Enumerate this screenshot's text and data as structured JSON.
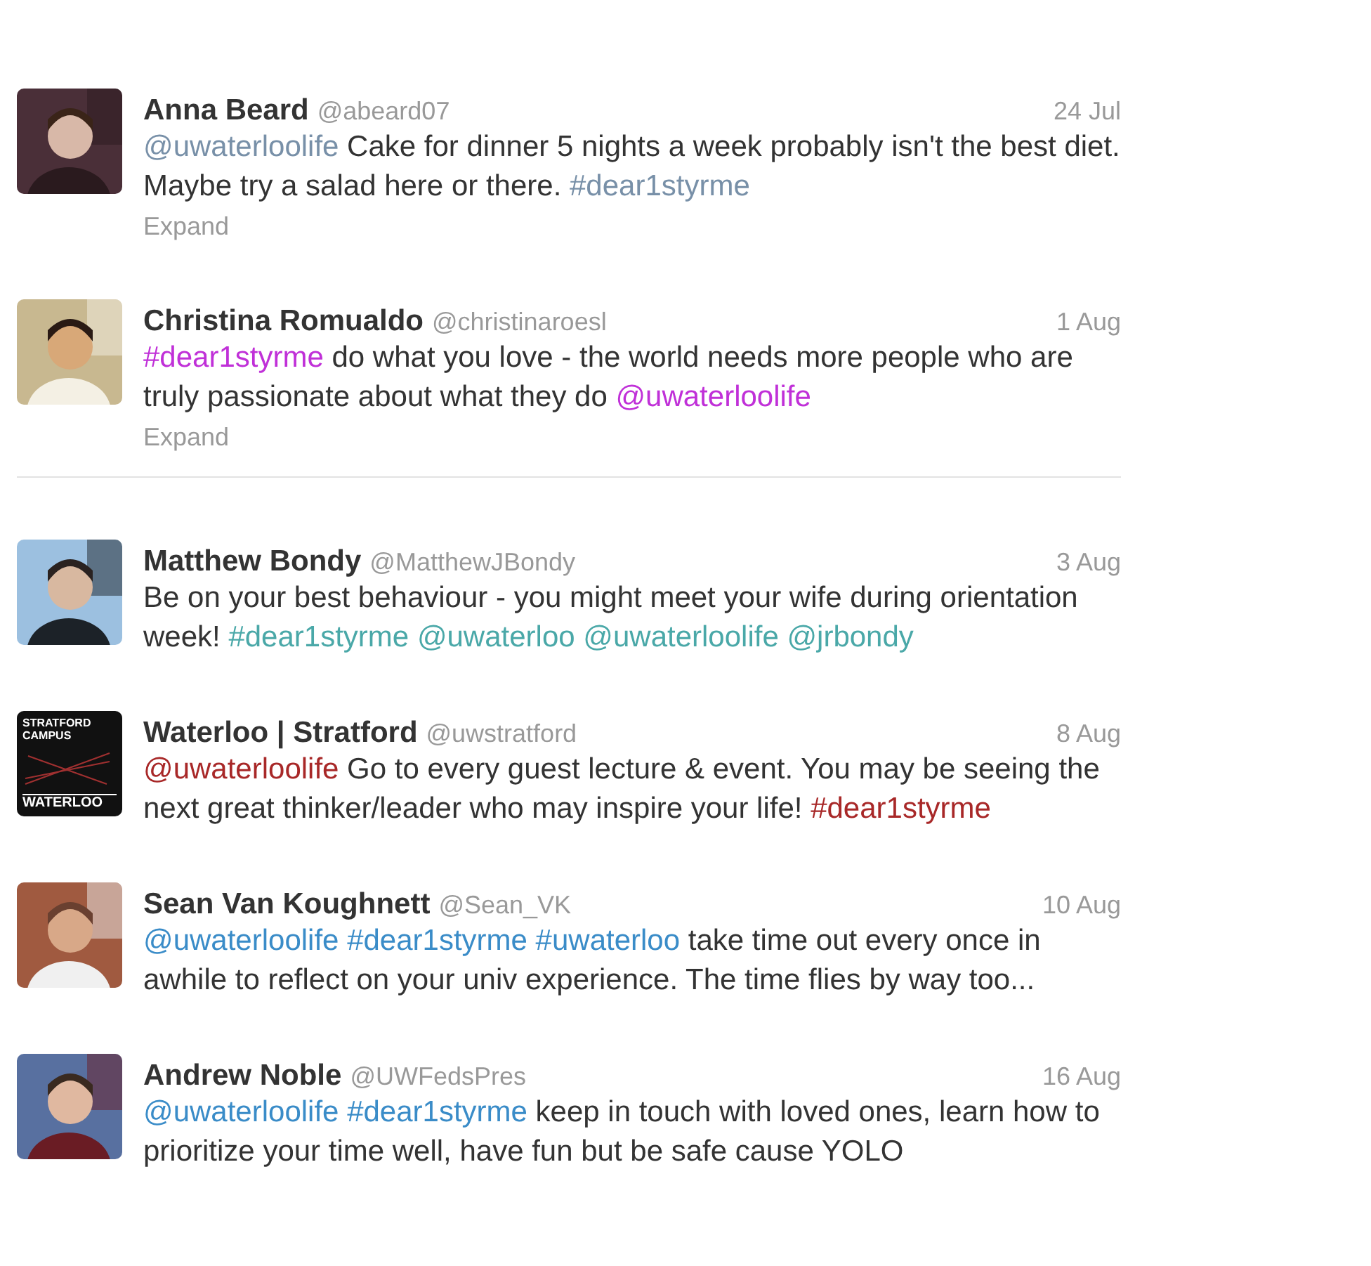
{
  "tweets": [
    {
      "avatar": {
        "kind": "picture"
      },
      "name": "Anna Beard",
      "handle": "@abeard07",
      "date": "24 Jul",
      "text": [
        {
          "text": "@uwaterloolife",
          "link": true,
          "color": "#7890a8"
        },
        {
          "text": " Cake for dinner 5 nights a week probably isn't the best diet. Maybe try a salad here or there. ",
          "link": false
        },
        {
          "text": "#dear1styrme",
          "link": true,
          "color": "#7890a8"
        }
      ],
      "expand": "Expand",
      "divider_below": false
    },
    {
      "avatar": {
        "kind": "picture"
      },
      "name": "Christina Romualdo",
      "handle": "@christinaroesl",
      "date": "1 Aug",
      "text": [
        {
          "text": "#dear1styrme",
          "link": true,
          "color": "#c030d8"
        },
        {
          "text": " do what you love - the world needs more people who are truly passionate about what they do ",
          "link": false
        },
        {
          "text": "@uwaterloolife",
          "link": true,
          "color": "#c030d8"
        }
      ],
      "expand": "Expand",
      "divider_below": true
    },
    {
      "avatar": {
        "kind": "picture"
      },
      "name": "Matthew Bondy",
      "handle": "@MatthewJBondy",
      "date": "3 Aug",
      "text": [
        {
          "text": "Be on your best behaviour - you might meet your wife during orientation week! ",
          "link": false
        },
        {
          "text": "#dear1styrme",
          "link": true,
          "color": "#4aa8a8"
        },
        {
          "text": "@uwaterloo",
          "link": true,
          "color": "#4aa8a8"
        },
        {
          "text": "@uwaterloolife",
          "link": true,
          "color": "#4aa8a8"
        },
        {
          "text": "@jrbondy",
          "link": true,
          "color": "#4aa8a8"
        }
      ],
      "divider_below": false
    },
    {
      "avatar": {
        "kind": "logo",
        "top": "STRATFORD CAMPUS",
        "bottom": "WATERLOO"
      },
      "name": "Waterloo | Stratford",
      "handle": "@uwstratford",
      "date": "8 Aug",
      "text": [
        {
          "text": "@uwaterloolife",
          "link": true,
          "color": "#a82828"
        },
        {
          "text": " Go to every guest lecture & event. You may be seeing the next great thinker/leader who may inspire your life! ",
          "link": false
        },
        {
          "text": "#dear1styrme",
          "link": true,
          "color": "#a82828"
        }
      ],
      "divider_below": false
    },
    {
      "avatar": {
        "kind": "picture"
      },
      "name": "Sean Van Koughnett",
      "handle": "@Sean_VK",
      "date": "10 Aug",
      "text": [
        {
          "text": "@uwaterloolife",
          "link": true,
          "color": "#3a8cc8"
        },
        {
          "text": "#dear1styrme",
          "link": true,
          "color": "#3a8cc8"
        },
        {
          "text": "#uwaterloo",
          "link": true,
          "color": "#3a8cc8"
        },
        {
          "text": " take time out every once in awhile to reflect on your univ experience. The time flies by way too...",
          "link": false
        }
      ],
      "divider_below": false
    },
    {
      "avatar": {
        "kind": "picture"
      },
      "name": "Andrew Noble",
      "handle": "@UWFedsPres",
      "date": "16 Aug",
      "text": [
        {
          "text": "@uwaterloolife",
          "link": true,
          "color": "#3a8cc8"
        },
        {
          "text": "#dear1styrme",
          "link": true,
          "color": "#3a8cc8"
        },
        {
          "text": " keep in touch with loved ones, learn how to prioritize your time well, have fun but be safe cause YOLO",
          "link": false
        }
      ],
      "divider_below": false
    }
  ]
}
